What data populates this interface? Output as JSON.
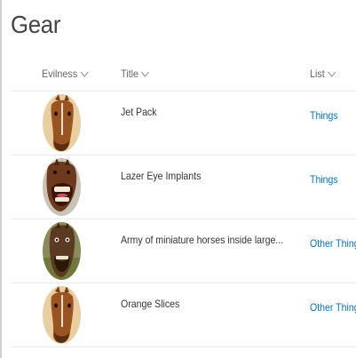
{
  "page": {
    "title": "Gear"
  },
  "columns": {
    "evilness": "Evilness",
    "title": "Title",
    "list": "List"
  },
  "rows": [
    {
      "title": "Jet Pack",
      "list": "Things",
      "avatar": "horse-icon"
    },
    {
      "title": "Lazer Eye Implants",
      "list": "Things",
      "avatar": "laughing-horse-icon"
    },
    {
      "title": "Army of miniature horses inside large...",
      "list": "Other Things",
      "avatar": "smiling-horse-icon"
    },
    {
      "title": "Orange Slices",
      "list": "Other Things",
      "avatar": "horse-icon"
    }
  ],
  "colors": {
    "link": "#0a72c7",
    "divider": "#eaeaea",
    "header_text": "#666666"
  }
}
